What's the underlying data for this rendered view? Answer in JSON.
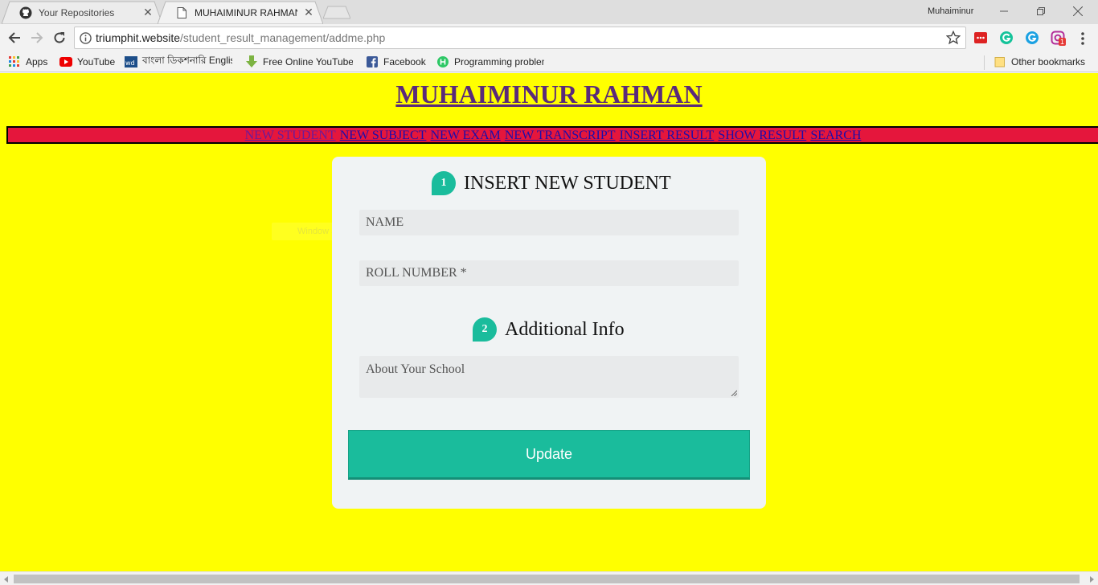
{
  "browser": {
    "tabs": [
      {
        "title": "Your Repositories",
        "icon": "github-icon"
      },
      {
        "title": "MUHAIMINUR RAHMAN",
        "icon": "page-icon"
      }
    ],
    "profile_name": "Muhaiminur",
    "url_host": "triumphit.website",
    "url_path": "/student_result_management/addme.php",
    "bookmarks": [
      {
        "label": "Apps",
        "icon": "apps-grid-icon"
      },
      {
        "label": "YouTube",
        "icon": "youtube-icon"
      },
      {
        "label": "বাংলা ডিকশনারি English",
        "icon": "dictionary-icon"
      },
      {
        "label": "Free Online YouTube",
        "icon": "download-arrow-icon"
      },
      {
        "label": "Facebook",
        "icon": "facebook-icon"
      },
      {
        "label": "Programming problem",
        "icon": "hackerrank-icon"
      }
    ],
    "other_bookmarks": "Other bookmarks",
    "extension_badge": "1"
  },
  "page": {
    "title": "MUHAIMINUR RAHMAN",
    "nav": [
      {
        "label": "NEW STUDENT",
        "visited": true
      },
      {
        "label": "NEW SUBJECT",
        "visited": false
      },
      {
        "label": "NEW EXAM",
        "visited": false
      },
      {
        "label": "NEW TRANSCRIPT",
        "visited": false
      },
      {
        "label": "INSERT RESULT",
        "visited": false
      },
      {
        "label": "SHOW RESULT",
        "visited": false
      },
      {
        "label": "SEARCH",
        "visited": false
      }
    ],
    "form": {
      "section1_number": "1",
      "section1_title": "INSERT NEW STUDENT",
      "name_placeholder": "NAME",
      "roll_placeholder": "ROLL NUMBER *",
      "section2_number": "2",
      "section2_title": "Additional Info",
      "school_placeholder": "About Your School",
      "submit_label": "Update"
    },
    "ghost_text": "Window Snip"
  },
  "colors": {
    "page_bg": "#ffff00",
    "nav_bg": "#e5163c",
    "accent": "#1abc9c",
    "card_bg": "#f0f3f4"
  }
}
